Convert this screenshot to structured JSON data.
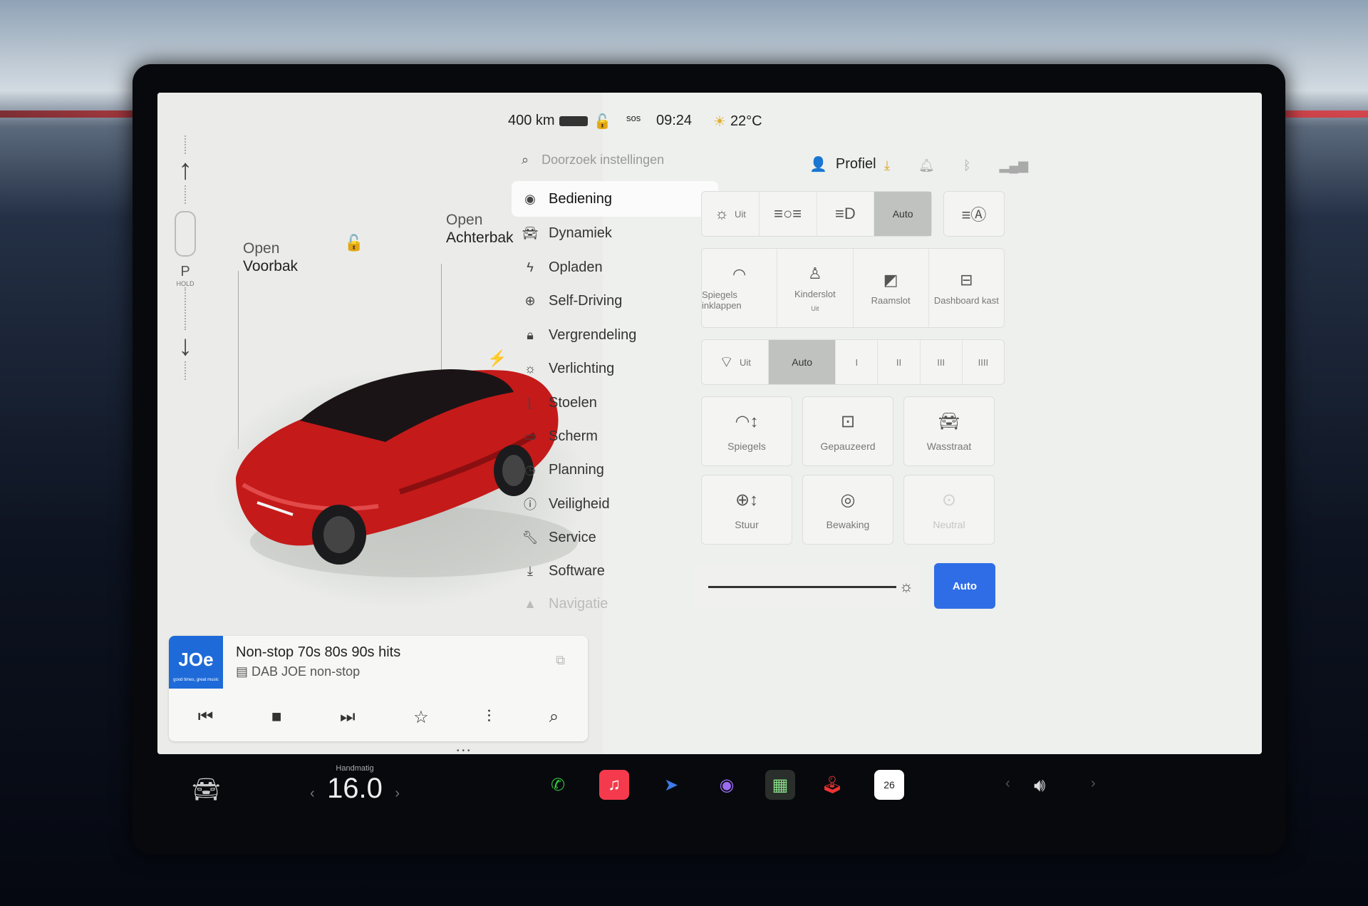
{
  "status": {
    "range": "400 km",
    "sos": "sos",
    "time": "09:24",
    "temperature": "22°C"
  },
  "gear": {
    "selected": "P",
    "hold_label": "HOLD"
  },
  "car_view": {
    "frunk_open_label": "Open",
    "frunk_label": "Voorbak",
    "trunk_open_label": "Open",
    "trunk_label": "Achterbak"
  },
  "media": {
    "station_logo_text": "JOe",
    "station_logo_tagline": "good times, great music",
    "title": "Non-stop 70s 80s 90s hits",
    "subtitle": "DAB JOE non-stop"
  },
  "settings": {
    "search_placeholder": "Doorzoek instellingen",
    "profile_label": "Profiel",
    "nav": [
      {
        "label": "Bediening",
        "icon": "toggle-icon"
      },
      {
        "label": "Dynamiek",
        "icon": "car-icon"
      },
      {
        "label": "Opladen",
        "icon": "bolt-icon"
      },
      {
        "label": "Self-Driving",
        "icon": "steering-wheel-icon"
      },
      {
        "label": "Vergrendeling",
        "icon": "lock-icon"
      },
      {
        "label": "Verlichting",
        "icon": "sun-icon"
      },
      {
        "label": "Stoelen",
        "icon": "seat-icon"
      },
      {
        "label": "Scherm",
        "icon": "display-icon"
      },
      {
        "label": "Planning",
        "icon": "alarm-icon"
      },
      {
        "label": "Veiligheid",
        "icon": "info-icon"
      },
      {
        "label": "Service",
        "icon": "wrench-icon"
      },
      {
        "label": "Software",
        "icon": "download-icon"
      },
      {
        "label": "Navigatie",
        "icon": "navigate-icon"
      }
    ],
    "active_nav": "Bediening"
  },
  "controls": {
    "lights": {
      "off": "Uit",
      "auto": "Auto"
    },
    "quick": {
      "fold_mirrors": "Spiegels inklappen",
      "child_lock": "Kinderslot",
      "child_lock_state": "Uit",
      "window_lock": "Raamslot",
      "glovebox": "Dashboard kast"
    },
    "wipers": {
      "off": "Uit",
      "auto": "Auto",
      "speeds": [
        "I",
        "II",
        "III",
        "IIII"
      ]
    },
    "tiles": {
      "mirrors": "Spiegels",
      "paused": "Gepauzeerd",
      "car_wash": "Wasstraat",
      "steering": "Stuur",
      "sentry": "Bewaking",
      "neutral": "Neutral"
    },
    "brightness_auto": "Auto"
  },
  "dock": {
    "climate_mode": "Handmatig",
    "cabin_temp": "16.0",
    "calendar_day": "26"
  },
  "colors": {
    "accent": "#2f6de6",
    "car_red": "#c51a1a",
    "phone_green": "#2fbf3a",
    "music_red": "#f43a4c"
  }
}
